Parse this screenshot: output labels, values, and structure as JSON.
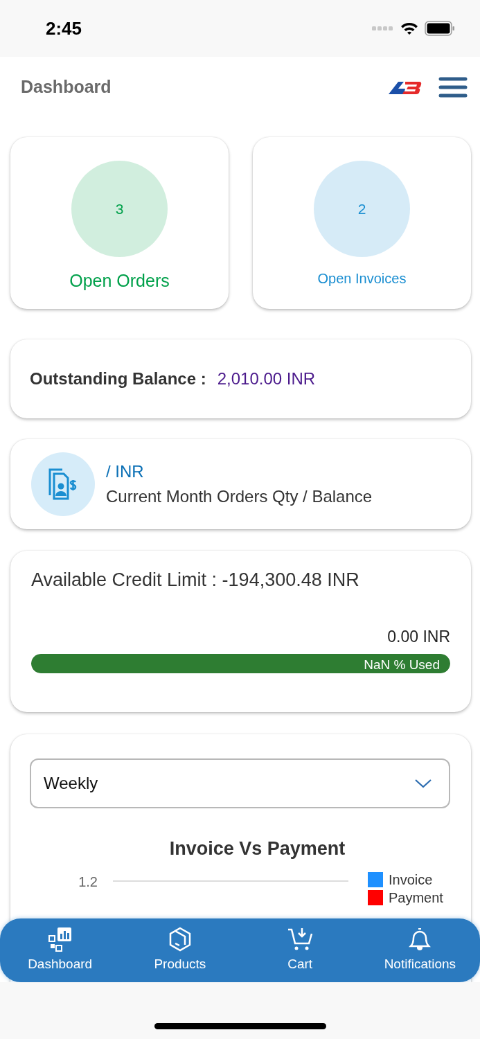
{
  "status_bar": {
    "time": "2:45"
  },
  "header": {
    "title": "Dashboard"
  },
  "tiles": [
    {
      "value": "3",
      "label": "Open Orders",
      "color": "#00a04a"
    },
    {
      "value": "2",
      "label": "Open Invoices",
      "color": "#1a8ed1"
    }
  ],
  "outstanding": {
    "label": "Outstanding Balance :",
    "value": "2,010.00 INR"
  },
  "current_month": {
    "value": "/ INR",
    "label": "Current Month Orders Qty / Balance"
  },
  "credit": {
    "label": "Available Credit Limit : -194,300.48 INR",
    "amount": "0.00 INR",
    "level": 1,
    "bar_text": "NaN % Used"
  },
  "chart_card": {
    "period": "Weekly",
    "title": "Invoice Vs Payment",
    "y_tick": "1.2",
    "legend": [
      {
        "label": "Invoice",
        "color": "#1e90ff"
      },
      {
        "label": "Payment",
        "color": "#ff0000"
      }
    ]
  },
  "tab_bar": [
    {
      "label": "Dashboard",
      "kind": "dashboard"
    },
    {
      "label": "Products",
      "kind": "products"
    },
    {
      "label": "Cart",
      "kind": "cart"
    },
    {
      "label": "Notifications",
      "kind": "bell"
    }
  ]
}
